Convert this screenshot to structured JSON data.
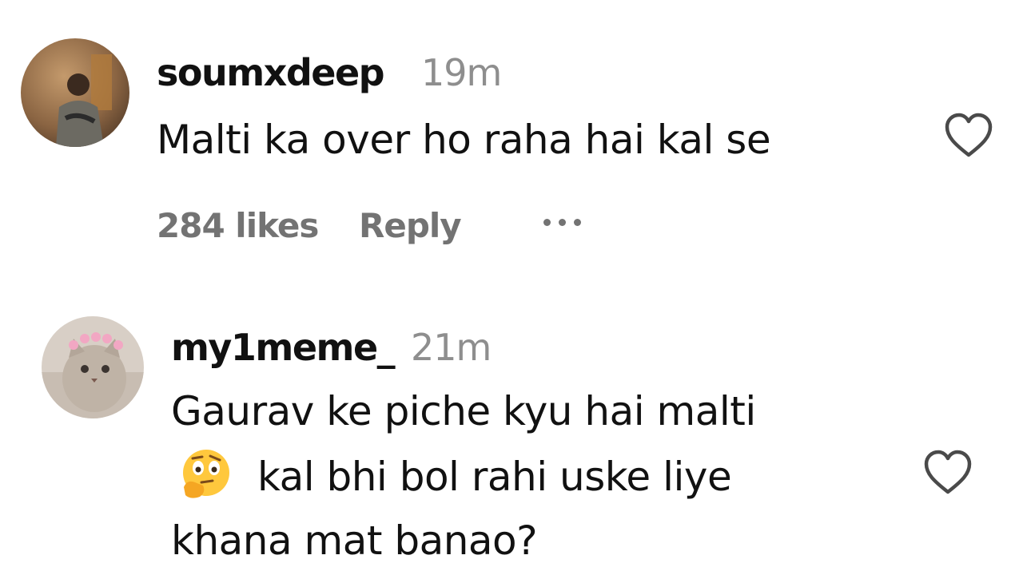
{
  "comments": [
    {
      "username": "soumxdeep",
      "time": "19m",
      "text": "Malti ka over ho raha hai kal se",
      "likes": "284 likes",
      "reply_label": "Reply"
    },
    {
      "username": "my1meme_",
      "time": "21m",
      "text_line1": "Gaurav ke piche kyu hai malti",
      "text_line2": "kal bhi bol rahi uske liye",
      "text_line3": "khana mat banao?",
      "emoji_icon": "thinking-face-emoji"
    }
  ],
  "colors": {
    "text": "#111111",
    "secondary": "#8e8e8e",
    "meta": "#737373"
  }
}
